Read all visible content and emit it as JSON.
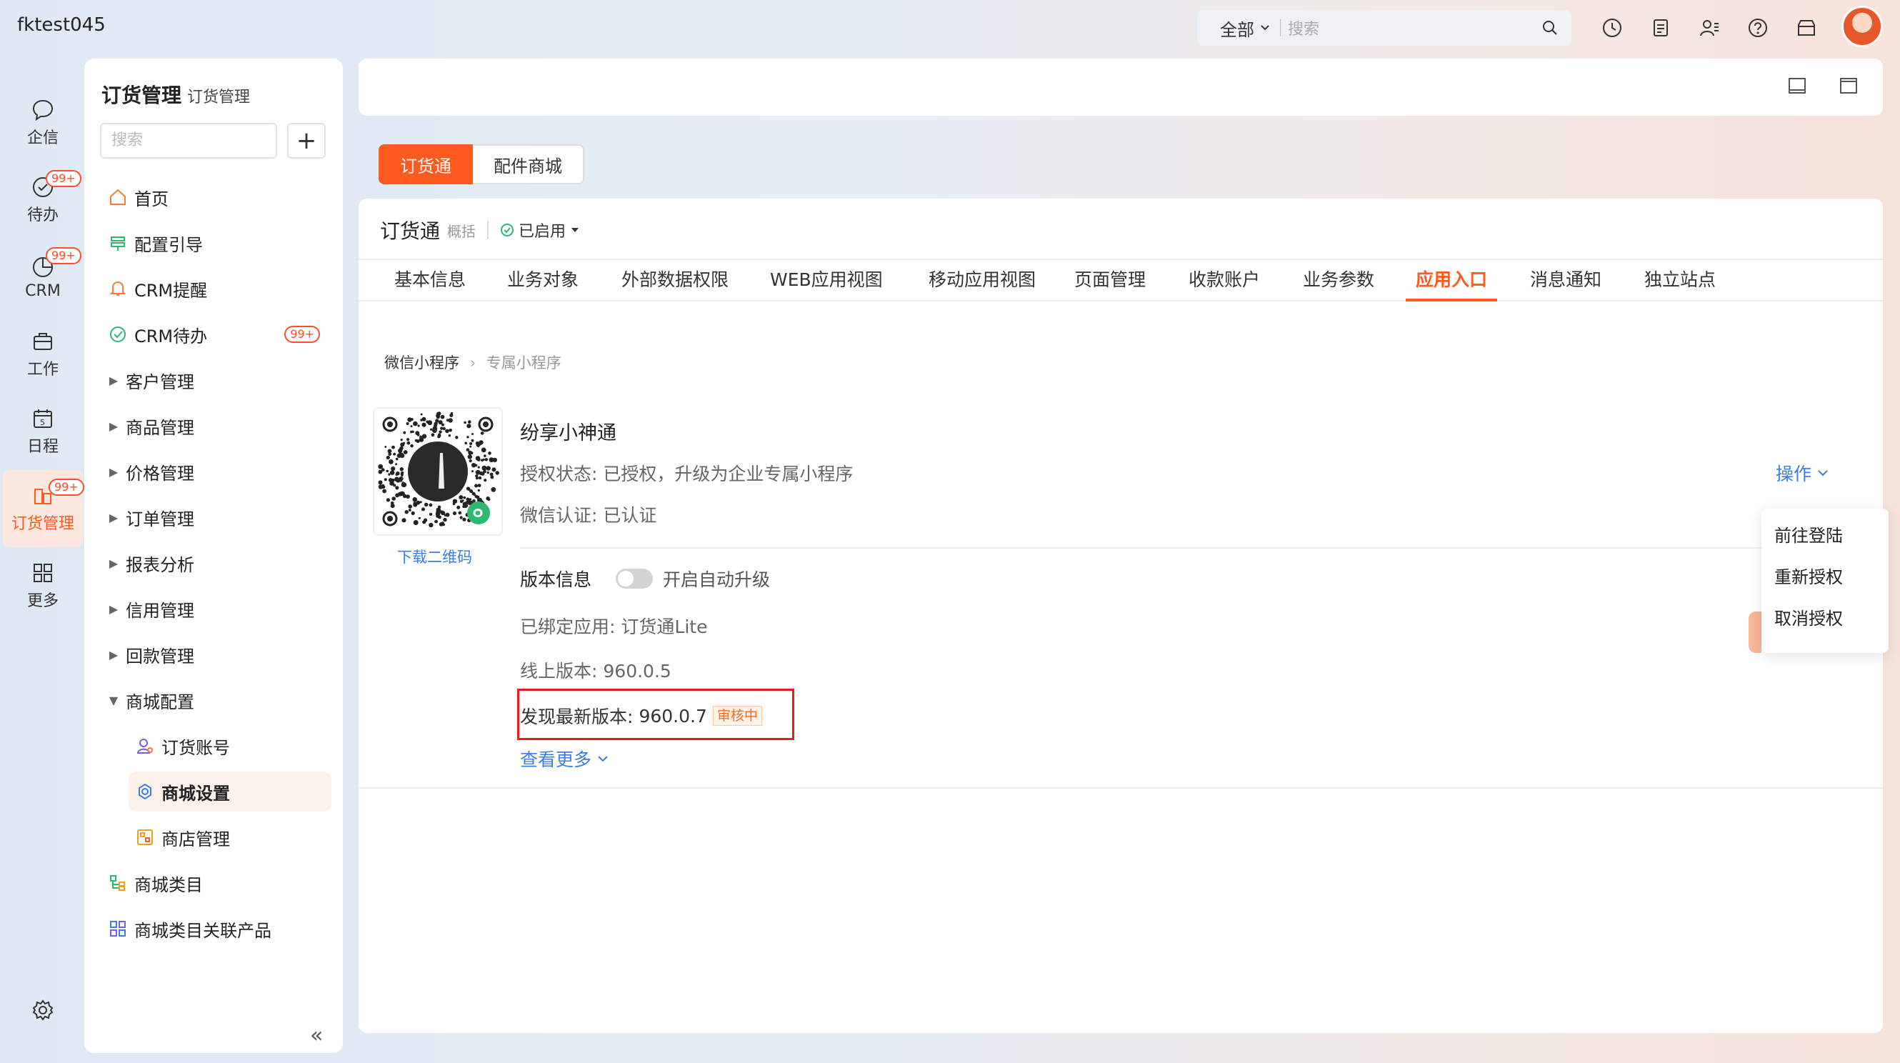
{
  "topbar": {
    "tenant": "fktest045",
    "search_scope": "全部",
    "search_placeholder": "搜索"
  },
  "iconnav": [
    {
      "label": "企信",
      "icon": "chat-icon"
    },
    {
      "label": "待办",
      "icon": "todo-icon",
      "badge": "99+"
    },
    {
      "label": "CRM",
      "icon": "crm-icon",
      "badge": "99+"
    },
    {
      "label": "工作",
      "icon": "briefcase-icon"
    },
    {
      "label": "日程",
      "icon": "calendar-icon"
    },
    {
      "label": "订货管理",
      "icon": "order-icon",
      "badge": "99+",
      "active": true
    },
    {
      "label": "更多",
      "icon": "grid-icon"
    }
  ],
  "menu": {
    "title": "订货管理",
    "subtitle": "订货管理",
    "search_placeholder": "搜索",
    "items": [
      {
        "label": "首页",
        "icon": "home-icon"
      },
      {
        "label": "配置引导",
        "icon": "guide-icon"
      },
      {
        "label": "CRM提醒",
        "icon": "bell-icon"
      },
      {
        "label": "CRM待办",
        "icon": "check-icon",
        "badge": "99+"
      },
      {
        "label": "客户管理"
      },
      {
        "label": "商品管理"
      },
      {
        "label": "价格管理"
      },
      {
        "label": "订单管理"
      },
      {
        "label": "报表分析"
      },
      {
        "label": "信用管理"
      },
      {
        "label": "回款管理"
      },
      {
        "label": "商城配置",
        "expanded": true
      },
      {
        "label": "订货账号",
        "icon": "account-icon",
        "sub": true
      },
      {
        "label": "商城设置",
        "icon": "settings-icon",
        "sub": true,
        "active": true
      },
      {
        "label": "商店管理",
        "icon": "store-icon",
        "sub": true
      },
      {
        "label": "商城类目",
        "icon": "category-icon"
      },
      {
        "label": "商城类目关联产品",
        "icon": "link-product-icon"
      }
    ]
  },
  "tabswitch": {
    "active": "订货通",
    "other": "配件商城"
  },
  "app": {
    "title": "订货通",
    "subtitle": "概括",
    "status": "已启用"
  },
  "subtabs": [
    "基本信息",
    "业务对象",
    "外部数据权限",
    "WEB应用视图",
    "移动应用视图",
    "页面管理",
    "收款账户",
    "业务参数",
    "应用入口",
    "消息通知",
    "独立站点"
  ],
  "active_subtab": "应用入口",
  "breadcrumb": {
    "parent": "微信小程序",
    "current": "专属小程序"
  },
  "mini": {
    "download_qr": "下载二维码",
    "name": "纷享小神通",
    "auth_label": "授权状态:",
    "auth_value": "已授权，升级为企业专属小程序",
    "cert_label": "微信认证:",
    "cert_value": "已认证",
    "operation": "操作",
    "version_label": "版本信息",
    "auto_upgrade": "开启自动升级",
    "bound_label": "已绑定应用:",
    "bound_value": "订货通Lite",
    "online_label": "线上版本:",
    "online_value": "960.0.5",
    "latest_label": "发现最新版本:",
    "latest_value": "960.0.7",
    "latest_tag": "审核中",
    "see_more": "查看更多"
  },
  "dropdown": [
    "前往登陆",
    "重新授权",
    "取消授权"
  ],
  "colors": {
    "accent": "#ff5a1f",
    "link": "#3b7de0",
    "highlight_box": "#e02020"
  }
}
